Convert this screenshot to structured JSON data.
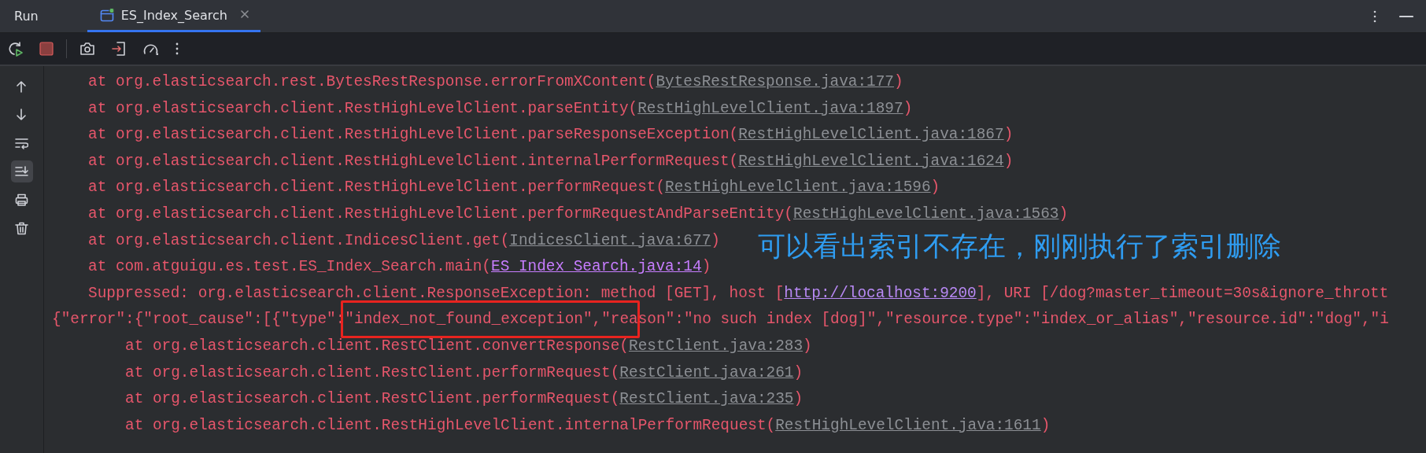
{
  "tool_window": {
    "title": "Run",
    "tabs": [
      {
        "label": "ES_Index_Search",
        "selected": true
      }
    ]
  },
  "toolbar": [
    {
      "kind": "rerun"
    },
    {
      "kind": "stop"
    },
    {
      "kind": "separator"
    },
    {
      "kind": "camera"
    },
    {
      "kind": "import"
    },
    {
      "kind": "gauge"
    },
    {
      "kind": "more"
    }
  ],
  "console": {
    "gutter_buttons": [
      {
        "kind": "up",
        "selected": false
      },
      {
        "kind": "down",
        "selected": false
      },
      {
        "kind": "wrap",
        "selected": false
      },
      {
        "kind": "scroll_end",
        "selected": true
      },
      {
        "kind": "print",
        "selected": false
      },
      {
        "kind": "trash",
        "selected": false
      }
    ],
    "lines": [
      {
        "kind": "frame",
        "segments": [
          {
            "kind": "plain",
            "text": "at org.elasticsearch.rest.BytesRestResponse.errorFromXContent("
          },
          {
            "kind": "library_link",
            "text": "BytesRestResponse.java:177"
          },
          {
            "kind": "plain",
            "text": ")"
          }
        ]
      },
      {
        "kind": "frame",
        "segments": [
          {
            "kind": "plain",
            "text": "at org.elasticsearch.client.RestHighLevelClient.parseEntity("
          },
          {
            "kind": "library_link",
            "text": "RestHighLevelClient.java:1897"
          },
          {
            "kind": "plain",
            "text": ")"
          }
        ]
      },
      {
        "kind": "frame",
        "segments": [
          {
            "kind": "plain",
            "text": "at org.elasticsearch.client.RestHighLevelClient.parseResponseException("
          },
          {
            "kind": "library_link",
            "text": "RestHighLevelClient.java:1867"
          },
          {
            "kind": "plain",
            "text": ")"
          }
        ]
      },
      {
        "kind": "frame",
        "segments": [
          {
            "kind": "plain",
            "text": "at org.elasticsearch.client.RestHighLevelClient.internalPerformRequest("
          },
          {
            "kind": "library_link",
            "text": "RestHighLevelClient.java:1624"
          },
          {
            "kind": "plain",
            "text": ")"
          }
        ]
      },
      {
        "kind": "frame",
        "segments": [
          {
            "kind": "plain",
            "text": "at org.elasticsearch.client.RestHighLevelClient.performRequest("
          },
          {
            "kind": "library_link",
            "text": "RestHighLevelClient.java:1596"
          },
          {
            "kind": "plain",
            "text": ")"
          }
        ]
      },
      {
        "kind": "frame",
        "segments": [
          {
            "kind": "plain",
            "text": "at org.elasticsearch.client.RestHighLevelClient.performRequestAndParseEntity("
          },
          {
            "kind": "library_link",
            "text": "RestHighLevelClient.java:1563"
          },
          {
            "kind": "plain",
            "text": ")"
          }
        ]
      },
      {
        "kind": "frame",
        "segments": [
          {
            "kind": "plain",
            "text": "at org.elasticsearch.client.IndicesClient.get("
          },
          {
            "kind": "library_link",
            "text": "IndicesClient.java:677"
          },
          {
            "kind": "plain",
            "text": ")"
          }
        ]
      },
      {
        "kind": "frame",
        "segments": [
          {
            "kind": "plain",
            "text": "at com.atguigu.es.test.ES_Index_Search.main("
          },
          {
            "kind": "project_link",
            "text": "ES_Index_Search.java:14"
          },
          {
            "kind": "plain",
            "text": ")"
          }
        ]
      },
      {
        "kind": "frame",
        "segments": [
          {
            "kind": "plain",
            "text": "Suppressed: org.elasticsearch.client.ResponseException: method [GET], host ["
          },
          {
            "kind": "url_link",
            "text": "http://localhost:9200"
          },
          {
            "kind": "plain",
            "text": "], URI [/dog?master_timeout=30s&ignore_thrott"
          }
        ]
      },
      {
        "kind": "response",
        "segments": [
          {
            "kind": "plain",
            "text": "{\"error\":{\"root_cause\":[{\"type\":\"index_not_found_exception\",\"reason\":\"no such index [dog]\",\"resource.type\":\"index_or_alias\",\"resource.id\":\"dog\",\"i"
          }
        ]
      },
      {
        "kind": "nested_frame",
        "segments": [
          {
            "kind": "plain",
            "text": "at org.elasticsearch.client.RestClient.convertResponse("
          },
          {
            "kind": "library_link",
            "text": "RestClient.java:283"
          },
          {
            "kind": "plain",
            "text": ")"
          }
        ]
      },
      {
        "kind": "nested_frame",
        "segments": [
          {
            "kind": "plain",
            "text": "at org.elasticsearch.client.RestClient.performRequest("
          },
          {
            "kind": "library_link",
            "text": "RestClient.java:261"
          },
          {
            "kind": "plain",
            "text": ")"
          }
        ]
      },
      {
        "kind": "nested_frame",
        "segments": [
          {
            "kind": "plain",
            "text": "at org.elasticsearch.client.RestClient.performRequest("
          },
          {
            "kind": "library_link",
            "text": "RestClient.java:235"
          },
          {
            "kind": "plain",
            "text": ")"
          }
        ]
      },
      {
        "kind": "nested_frame",
        "segments": [
          {
            "kind": "plain",
            "text": "at org.elasticsearch.client.RestHighLevelClient.internalPerformRequest("
          },
          {
            "kind": "library_link",
            "text": "RestHighLevelClient.java:1611"
          },
          {
            "kind": "plain",
            "text": ")"
          }
        ]
      }
    ]
  },
  "annotation": {
    "text": "可以看出索引不存在，刚刚执行了索引删除"
  }
}
